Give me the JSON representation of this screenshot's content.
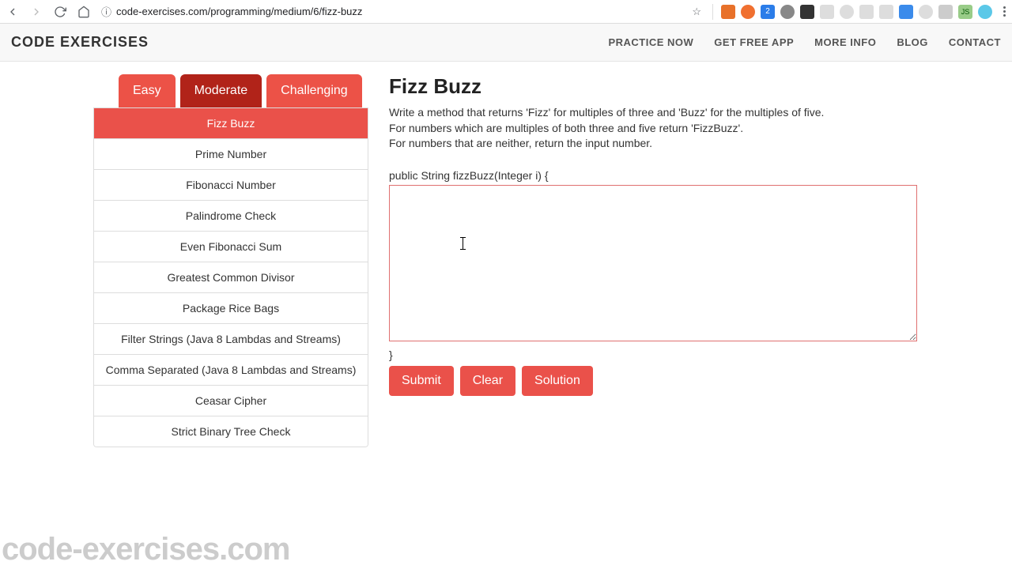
{
  "browser": {
    "url": "code-exercises.com/programming/medium/6/fizz-buzz"
  },
  "header": {
    "logo": "CODE EXERCISES",
    "nav": [
      "PRACTICE NOW",
      "GET FREE APP",
      "MORE INFO",
      "BLOG",
      "CONTACT"
    ]
  },
  "tabs": {
    "easy": "Easy",
    "moderate": "Moderate",
    "challenging": "Challenging"
  },
  "exercises": [
    "Fizz Buzz",
    "Prime Number",
    "Fibonacci Number",
    "Palindrome Check",
    "Even Fibonacci Sum",
    "Greatest Common Divisor",
    "Package Rice Bags",
    "Filter Strings (Java 8 Lambdas and Streams)",
    "Comma Separated (Java 8 Lambdas and Streams)",
    "Ceasar Cipher",
    "Strict Binary Tree Check"
  ],
  "problem": {
    "title": "Fizz Buzz",
    "desc1": "Write a method that returns 'Fizz' for multiples of three and 'Buzz' for the multiples of five.",
    "desc2": "For numbers which are multiples of both three and five return 'FizzBuzz'.",
    "desc3": "For numbers that are neither, return the input number.",
    "signature": "public String fizzBuzz(Integer i) {",
    "closing": "}",
    "code_value": ""
  },
  "buttons": {
    "submit": "Submit",
    "clear": "Clear",
    "solution": "Solution"
  },
  "watermark": "code-exercises.com"
}
